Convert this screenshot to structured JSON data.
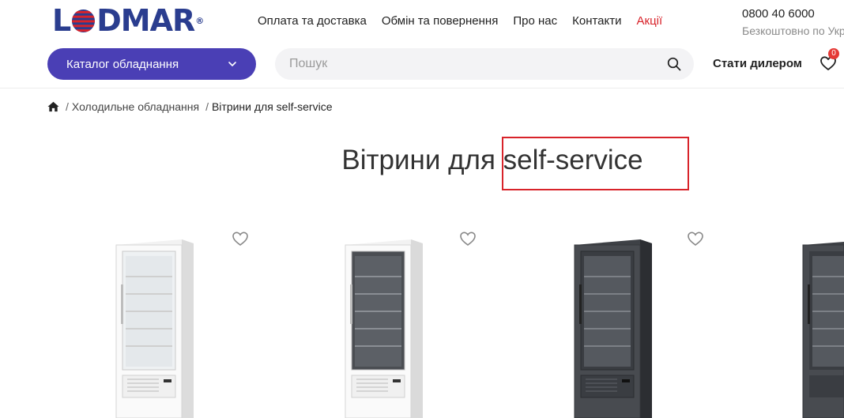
{
  "header": {
    "logo_text": "LODMAR",
    "logo_prefix": "L",
    "logo_suffix": "DMAR",
    "logo_registered": "®",
    "nav": [
      {
        "label": "Оплата та доставка"
      },
      {
        "label": "Обмін та повернення"
      },
      {
        "label": "Про нас"
      },
      {
        "label": "Контакти"
      },
      {
        "label": "Акції"
      }
    ],
    "phone": "0800 40 6000",
    "phone_note": "Безкоштовно по Укр",
    "catalog_label": "Каталог обладнання",
    "search_placeholder": "Пошук",
    "dealer_label": "Стати дилером",
    "wishlist_count": "0"
  },
  "breadcrumb": {
    "category": "Холодильне обладнання",
    "current": "Вітрини для self-service",
    "separator": "/"
  },
  "page": {
    "title": "Вітрини для self-service",
    "highlighted_text": "self-service"
  },
  "products": [
    {
      "color": "white",
      "icon": "heart-icon"
    },
    {
      "color": "white-dark-interior",
      "icon": "heart-icon"
    },
    {
      "color": "graphite",
      "icon": "heart-icon"
    },
    {
      "color": "graphite",
      "icon": "heart-icon"
    }
  ],
  "colors": {
    "brand": "#2a3d8f",
    "catalog_button": "#4a3fb5",
    "promo": "#d8232a",
    "badge": "#e53935",
    "highlight_border": "#d8232a"
  }
}
